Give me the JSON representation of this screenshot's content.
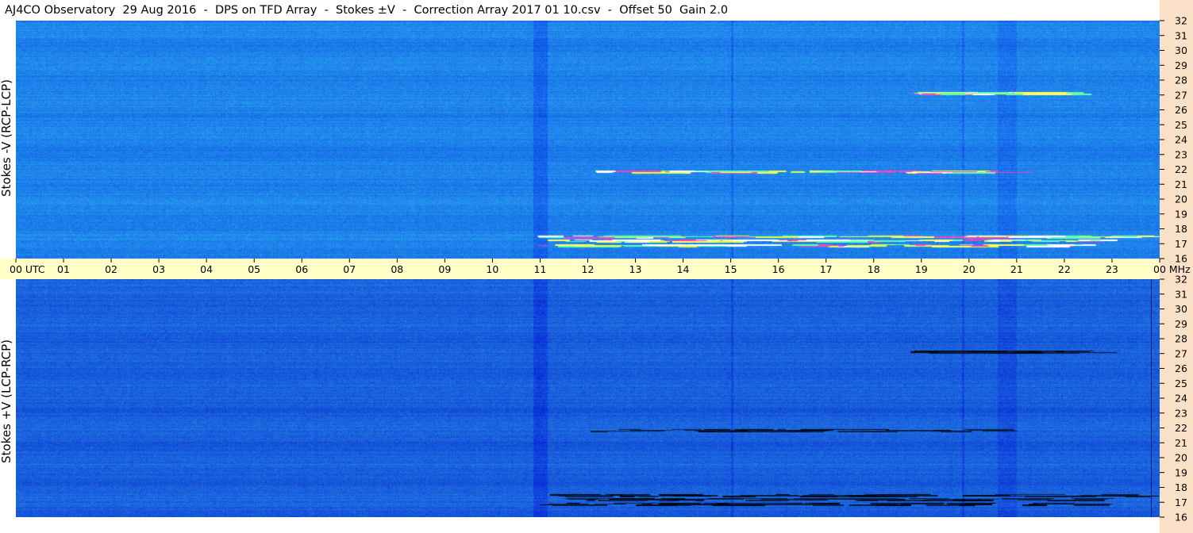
{
  "title": "AJ4CO Observatory  29 Aug 2016  -  DPS on TFD Array  -  Stokes ±V  -  Correction Array 2017 01 10.csv  -  Offset 50  Gain 2.0",
  "panels": {
    "top": {
      "ylabel": "Stokes -V (RCP-LCP)"
    },
    "bottom": {
      "ylabel": "Stokes +V (LCP-RCP)"
    }
  },
  "time_axis": {
    "labels": [
      "00 UTC",
      "01",
      "02",
      "03",
      "04",
      "05",
      "06",
      "07",
      "08",
      "09",
      "10",
      "11",
      "12",
      "13",
      "14",
      "15",
      "16",
      "17",
      "18",
      "19",
      "20",
      "21",
      "22",
      "23",
      "00 MHz"
    ]
  },
  "freq_axis": {
    "labels": [
      "32",
      "31",
      "30",
      "29",
      "28",
      "27",
      "26",
      "25",
      "24",
      "23",
      "22",
      "21",
      "20",
      "19",
      "18",
      "17",
      "16"
    ]
  },
  "chart_data": {
    "type": "heatmap",
    "title": "AJ4CO Observatory  29 Aug 2016  -  DPS on TFD Array  -  Stokes ±V  -  Correction Array 2017 01 10.csv  -  Offset 50  Gain 2.0",
    "xlabel": "UTC",
    "ylabel": "MHz",
    "xlim": [
      0,
      24
    ],
    "ylim": [
      16,
      32
    ],
    "panels": [
      "Stokes -V (RCP-LCP)",
      "Stokes +V (LCP-RCP)"
    ],
    "grid": false,
    "colors": {
      "background": "#2a7fe8",
      "time_bar": "#ffffc8",
      "freq_bar": "#fbe0c8"
    }
  }
}
